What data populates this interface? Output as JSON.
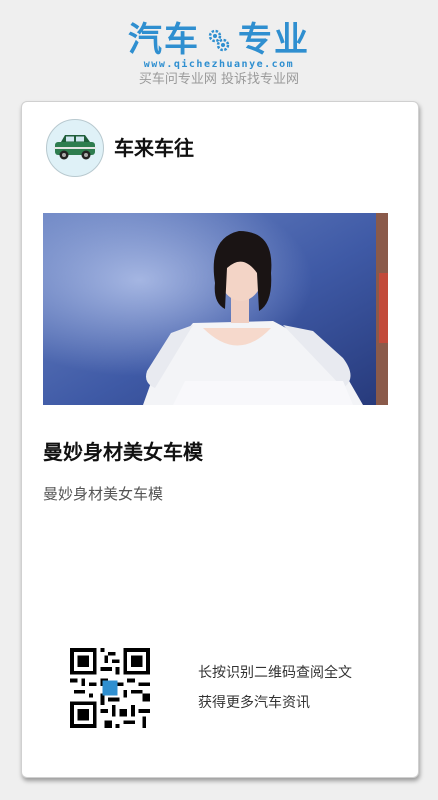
{
  "brand": {
    "logo_left": "汽车",
    "logo_right": "专业",
    "url": "www.qichezhuanye.com",
    "tagline": "买车问专业网 投诉找专业网",
    "color": "#2f8fd0",
    "gear_icon": "gear-icon"
  },
  "card": {
    "author": "车来车往",
    "avatar_icon": "car-icon",
    "title": "曼妙身材美女车模",
    "summary": "曼妙身材美女车模",
    "qr_caption_line1": "长按识别二维码查阅全文",
    "qr_caption_line2": "获得更多汽车资讯",
    "qr_icon": "qr-code-icon"
  }
}
